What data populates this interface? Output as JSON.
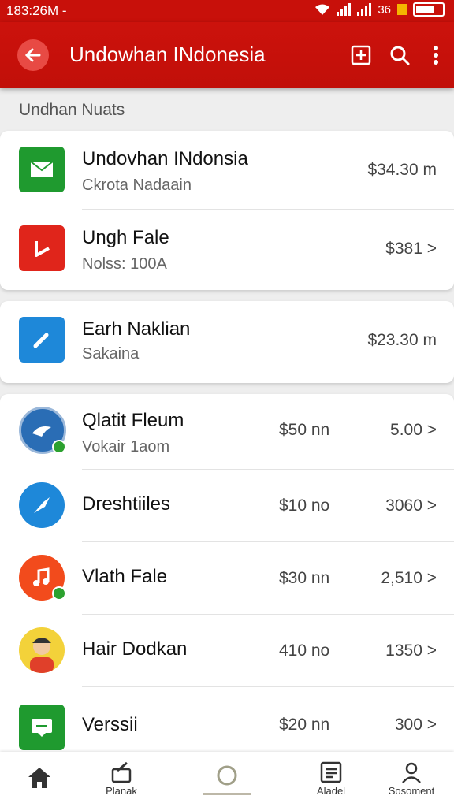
{
  "status_bar": {
    "time": "183:26M -",
    "extra": "36"
  },
  "app_bar": {
    "title": "Undowhan INdonesia"
  },
  "section_label": "Undhan Nuats",
  "card1": [
    {
      "title": "Undovhan INdonsia",
      "subtitle": "Ckrota Nadaain",
      "value": "$34.30 m"
    },
    {
      "title": "Ungh Fale",
      "subtitle": "Nolss: 100A",
      "value": "$381 >"
    }
  ],
  "card2": [
    {
      "title": "Earh Naklian",
      "subtitle": "Sakaina",
      "value": "$23.30 m"
    }
  ],
  "list": [
    {
      "title": "Qlatit Fleum",
      "subtitle": "Vokair 1aom",
      "value1": "$50 nn",
      "value2": "5.00 >"
    },
    {
      "title": "Dreshtiiles",
      "subtitle": "",
      "value1": "$10 no",
      "value2": "3060 >"
    },
    {
      "title": "Vlath Fale",
      "subtitle": "",
      "value1": "$30 nn",
      "value2": "2,510 >"
    },
    {
      "title": "Hair Dodkan",
      "subtitle": "",
      "value1": "410 no",
      "value2": "1350 >"
    },
    {
      "title": "Verssii",
      "subtitle": "",
      "value1": "$20 nn",
      "value2": "300 >"
    }
  ],
  "bottom_nav": [
    {
      "label": ""
    },
    {
      "label": "Planak"
    },
    {
      "label": ""
    },
    {
      "label": "Aladel"
    },
    {
      "label": "Sosoment"
    }
  ],
  "colors": {
    "primary": "#c8100a",
    "green": "#1f9a2f",
    "red": "#e0251b",
    "blue": "#1e88d9",
    "orange": "#f24b1c"
  }
}
